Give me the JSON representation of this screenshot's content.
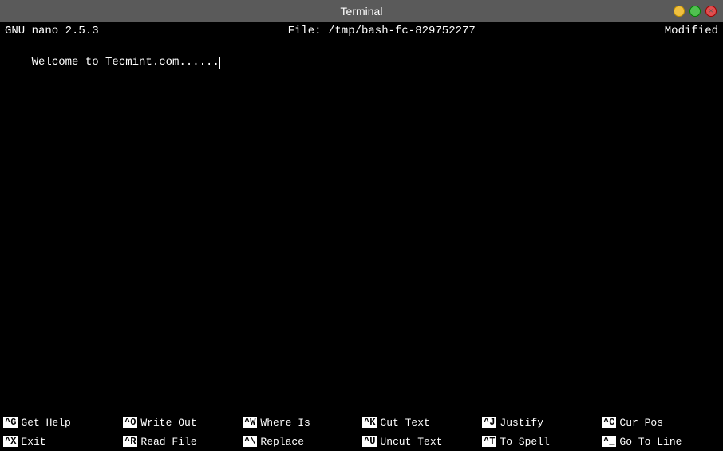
{
  "titleBar": {
    "title": "Terminal"
  },
  "nanoHeader": {
    "version": "GNU nano 2.5.3",
    "file": "File: /tmp/bash-fc-829752277",
    "status": "Modified"
  },
  "editor": {
    "content": "Welcome to Tecmint.com......"
  },
  "shortcuts": {
    "row1": [
      {
        "key": "^G",
        "label": "Get Help"
      },
      {
        "key": "^O",
        "label": "Write Out"
      },
      {
        "key": "^W",
        "label": "Where Is"
      },
      {
        "key": "^K",
        "label": "Cut Text"
      },
      {
        "key": "^J",
        "label": "Justify"
      },
      {
        "key": "^C",
        "label": "Cur Pos"
      }
    ],
    "row2": [
      {
        "key": "^X",
        "label": "Exit"
      },
      {
        "key": "^R",
        "label": "Read File"
      },
      {
        "key": "^\\",
        "label": "Replace"
      },
      {
        "key": "^U",
        "label": "Uncut Text"
      },
      {
        "key": "^T",
        "label": "To Spell"
      },
      {
        "key": "^_",
        "label": "Go To Line"
      }
    ]
  }
}
